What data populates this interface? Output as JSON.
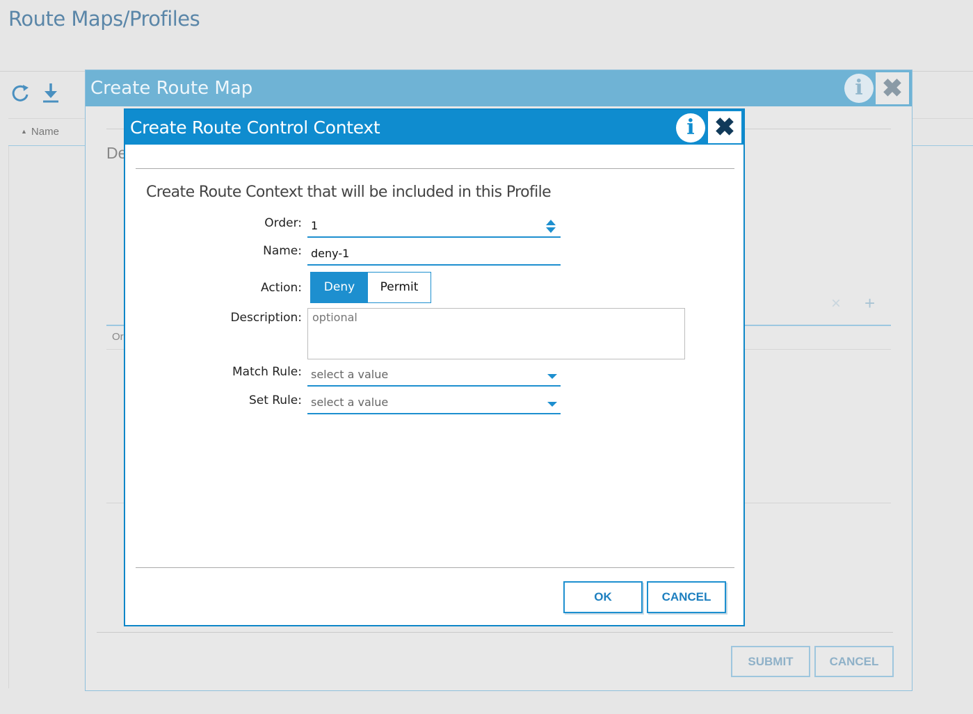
{
  "page": {
    "title": "Route Maps/Profiles",
    "toolbar": {
      "refresh_icon": "refresh-icon",
      "download_icon": "download-icon"
    },
    "table": {
      "sort_indicator": "▲",
      "col_name": "Name"
    }
  },
  "outer_dialog": {
    "title": "Create Route Map",
    "info_icon": "i",
    "close_icon": "✖",
    "partial_label": "De",
    "partial_col": "Or",
    "delete_icon": "×",
    "add_icon": "+",
    "submit_label": "SUBMIT",
    "cancel_label": "CANCEL"
  },
  "inner_dialog": {
    "title": "Create Route Control Context",
    "info_icon": "i",
    "close_icon": "✖",
    "heading": "Create Route Context that will be included in this Profile",
    "fields": {
      "order": {
        "label": "Order:",
        "value": "1"
      },
      "name": {
        "label": "Name:",
        "value": "deny-1"
      },
      "action": {
        "label": "Action:",
        "options": [
          "Deny",
          "Permit"
        ],
        "selected": "Deny"
      },
      "description": {
        "label": "Description:",
        "placeholder": "optional"
      },
      "match_rule": {
        "label": "Match Rule:",
        "placeholder": "select a value"
      },
      "set_rule": {
        "label": "Set Rule:",
        "placeholder": "select a value"
      }
    },
    "ok_label": "OK",
    "cancel_label": "CANCEL"
  },
  "colors": {
    "primary": "#0f8ccf",
    "outer_header": "#6fb3d5",
    "page_title": "#5a86a8"
  }
}
